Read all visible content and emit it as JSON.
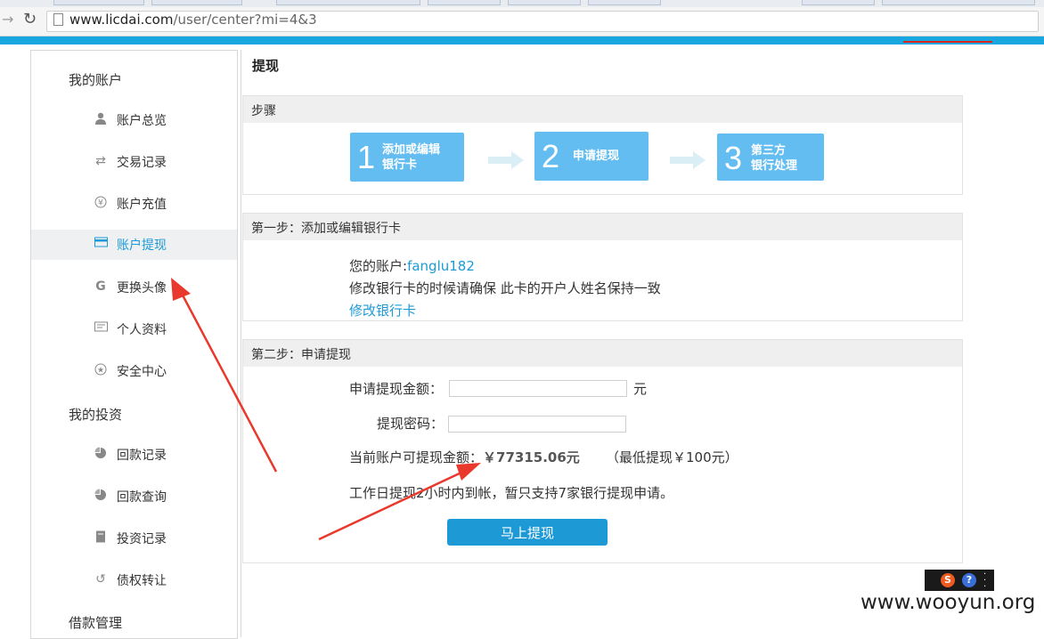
{
  "browser": {
    "url_domain": "www.licdai.com",
    "url_path": "/user/center?mi=4&3"
  },
  "sidebar": {
    "account_section": "我的账户",
    "account_items": [
      {
        "label": "账户总览",
        "icon": "user-icon"
      },
      {
        "label": "交易记录",
        "icon": "transfer-icon"
      },
      {
        "label": "账户充值",
        "icon": "yuan-icon"
      },
      {
        "label": "账户提现",
        "icon": "card-icon",
        "active": true
      },
      {
        "label": "更换头像",
        "icon": "refresh-g-icon"
      },
      {
        "label": "个人资料",
        "icon": "id-card-icon"
      },
      {
        "label": "安全中心",
        "icon": "star-icon"
      }
    ],
    "invest_section": "我的投资",
    "invest_items": [
      {
        "label": "回款记录",
        "icon": "pie-icon"
      },
      {
        "label": "回款查询",
        "icon": "pie-icon"
      },
      {
        "label": "投资记录",
        "icon": "document-icon"
      },
      {
        "label": "债权转让",
        "icon": "undo-icon"
      }
    ],
    "loan_section": "借款管理"
  },
  "main": {
    "title": "提现",
    "steps_panel": {
      "header": "步骤",
      "steps": [
        {
          "num": "1",
          "line1": "添加或编辑",
          "line2": "银行卡"
        },
        {
          "num": "2",
          "line1": "申请提现",
          "line2": ""
        },
        {
          "num": "3",
          "line1": "第三方",
          "line2": "银行处理"
        }
      ]
    },
    "step1_panel": {
      "header": "第一步：添加或编辑银行卡",
      "account_label": "您的账户:",
      "account_name": "fanglu182",
      "notice": "修改银行卡的时候请确保 此卡的开户人姓名保持一致",
      "edit_link": "修改银行卡"
    },
    "step2_panel": {
      "header": "第二步：申请提现",
      "amount_label": "申请提现金额：",
      "amount_value": "",
      "amount_unit": "元",
      "password_label": "提现密码：",
      "password_value": "",
      "available_label": "当前账户可提现金额：",
      "available_amount": "￥77315.06元",
      "min_note": "（最低提现￥100元）",
      "info": "工作日提现2小时内到帐，暂只支持7家银行提现申请。",
      "submit_label": "马上提现"
    }
  },
  "watermark": {
    "text": "www.wooyun.org"
  },
  "colors": {
    "accent": "#1d9ad6",
    "top_bar": "#18a7df",
    "step_box": "#64bdf0",
    "annotation_arrow": "#e8392c"
  }
}
